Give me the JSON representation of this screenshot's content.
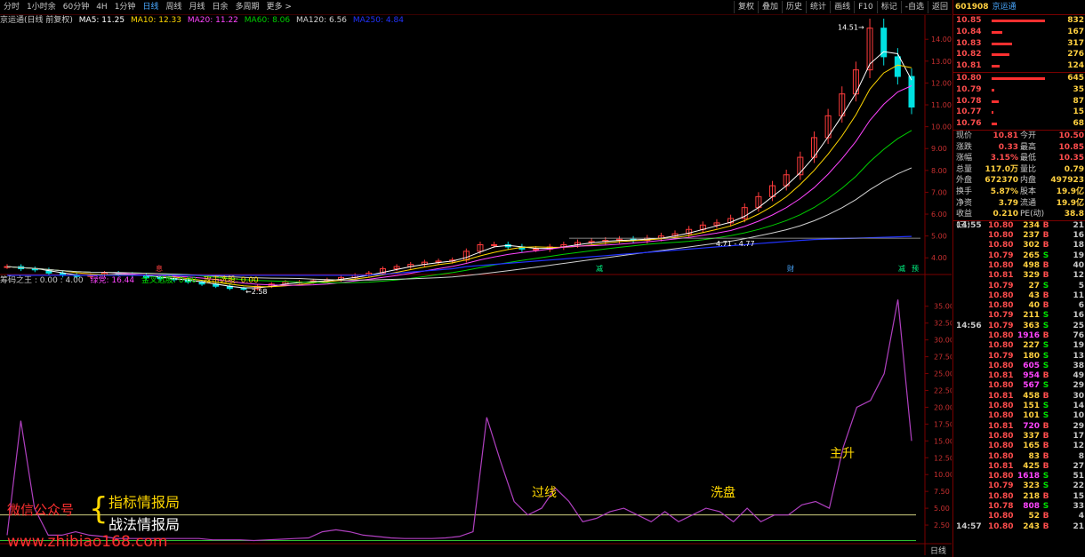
{
  "toolbar": {
    "tabs": [
      "分时",
      "1小时余",
      "60分钟",
      "4H",
      "1分钟",
      "日线",
      "周线",
      "月线",
      "日余",
      "多周期",
      "更多 >"
    ],
    "active_tab": "日线",
    "right_buttons": [
      "复权",
      "叠加",
      "历史",
      "统计",
      "画线",
      "F10",
      "标记",
      "-自选",
      "返回"
    ]
  },
  "info": {
    "title": "京运通(日线 前复权)",
    "ma5": "MA5: 11.25",
    "ma10": "MA10: 12.33",
    "ma20": "MA20: 11.22",
    "ma60": "MA60: 8.06",
    "ma120": "MA120: 6.56",
    "ma250": "MA250: 4.84"
  },
  "colors": {
    "up": "#ff3b3b",
    "down": "#00e0e0",
    "ma5": "#ffffff",
    "ma10": "#ffd700",
    "ma20": "#ff44ff",
    "ma60": "#00d000",
    "ma120": "#d0d0d0",
    "ma250": "#2233ff",
    "indicator": "#b040c0",
    "level_line": "#d0d080",
    "level_line2": "#30c030"
  },
  "chart_data": [
    {
      "type": "line",
      "name": "price",
      "y_ticks": [
        "14.00",
        "13.00",
        "12.00",
        "11.00",
        "10.00",
        "9.00",
        "8.00",
        "7.00",
        "6.00",
        "5.00",
        "4.00"
      ],
      "ylim": [
        3.4,
        14.7
      ],
      "high_label": "14.51",
      "low_label": "2.58",
      "range_label": "4.71 - 4.77",
      "markers": [
        "息",
        "减",
        "财",
        "减",
        "预"
      ],
      "close": [
        3.6,
        3.5,
        3.45,
        3.3,
        3.2,
        3.15,
        3.2,
        3.3,
        3.25,
        3.2,
        3.1,
        3.05,
        3.0,
        2.9,
        2.8,
        2.7,
        2.6,
        2.58,
        2.7,
        2.8,
        2.9,
        2.9,
        2.95,
        3.0,
        3.1,
        3.2,
        3.3,
        3.5,
        3.6,
        3.7,
        3.8,
        3.85,
        3.9,
        4.3,
        4.6,
        4.6,
        4.5,
        4.4,
        4.4,
        4.5,
        4.6,
        4.7,
        4.75,
        4.8,
        4.85,
        4.8,
        4.9,
        5.0,
        5.1,
        5.3,
        5.5,
        5.6,
        5.8,
        6.3,
        6.8,
        7.3,
        7.8,
        8.6,
        9.5,
        10.5,
        11.5,
        12.6,
        14.51,
        13.2,
        12.3,
        10.9
      ],
      "ma250": [
        3.2,
        3.2,
        3.2,
        3.2,
        3.2,
        3.2,
        3.2,
        3.2,
        3.2,
        3.2,
        3.2,
        3.2,
        3.2,
        3.2,
        3.2,
        3.2,
        3.2,
        3.2,
        3.2,
        3.2,
        3.2,
        3.2,
        3.2,
        3.2,
        3.2,
        3.2,
        3.2,
        3.25,
        3.3,
        3.35,
        3.4,
        3.45,
        3.5,
        3.6,
        3.65,
        3.7,
        3.75,
        3.8,
        3.85,
        3.9,
        3.95,
        4.0,
        4.05,
        4.1,
        4.15,
        4.2,
        4.25,
        4.3,
        4.35,
        4.4,
        4.45,
        4.5,
        4.55,
        4.6,
        4.65,
        4.7,
        4.75,
        4.8,
        4.84,
        4.86,
        4.88,
        4.9,
        4.92,
        4.94,
        4.96,
        4.98
      ]
    },
    {
      "type": "line",
      "name": "筹码之王",
      "y_ticks": [
        "35.00",
        "32.50",
        "30.00",
        "27.50",
        "25.00",
        "22.50",
        "20.00",
        "17.50",
        "15.00",
        "12.50",
        "10.00",
        "7.50",
        "5.00",
        "2.50"
      ],
      "ylim": [
        0,
        38
      ],
      "values": [
        1,
        18,
        5,
        1,
        1,
        1.5,
        1,
        0.8,
        0.5,
        0.5,
        0.5,
        0.5,
        0.5,
        0.5,
        0.5,
        0.3,
        0.3,
        0.3,
        0.2,
        0.3,
        0.4,
        0.5,
        0.6,
        1.5,
        1.8,
        1.5,
        1,
        0.8,
        0.6,
        0.5,
        0.5,
        0.5,
        0.6,
        0.8,
        1.5,
        18.5,
        12,
        6,
        4,
        5,
        8,
        6,
        3,
        3.5,
        4.5,
        5,
        4,
        3,
        4.5,
        3,
        4,
        5,
        4.5,
        3,
        5,
        3,
        4,
        4,
        5.5,
        6,
        5,
        14,
        20,
        21,
        25,
        36,
        15
      ]
    },
    {
      "type": "table",
      "name": "order_book",
      "sell": [
        {
          "price": "10.85",
          "vol": "832"
        },
        {
          "price": "10.84",
          "vol": "167"
        },
        {
          "price": "10.83",
          "vol": "317"
        },
        {
          "price": "10.82",
          "vol": "276"
        },
        {
          "price": "10.81",
          "vol": "124"
        }
      ],
      "buy": [
        {
          "price": "10.80",
          "vol": "645"
        },
        {
          "price": "10.79",
          "vol": "35"
        },
        {
          "price": "10.78",
          "vol": "87"
        },
        {
          "price": "10.77",
          "vol": "15"
        },
        {
          "price": "10.76",
          "vol": "68"
        }
      ]
    }
  ],
  "right_panel": {
    "code": "601908",
    "name": "京运通",
    "stats": [
      {
        "k": "现价",
        "v1": "10.81",
        "k2": "今开",
        "v2": "10.50"
      },
      {
        "k": "涨跌",
        "v1": "0.33",
        "k2": "最高",
        "v2": "10.85"
      },
      {
        "k": "涨幅",
        "v1": "3.15%",
        "k2": "最低",
        "v2": "10.35"
      },
      {
        "k": "总量",
        "v1": "117.0万",
        "k2": "量比",
        "v2": "0.79"
      },
      {
        "k": "外盘",
        "v1": "672370",
        "k2": "内盘",
        "v2": "497923"
      },
      {
        "k": "换手",
        "v1": "5.87%",
        "k2": "股本",
        "v2": "19.9亿"
      },
      {
        "k": "净资",
        "v1": "3.79",
        "k2": "流通",
        "v2": "19.9亿"
      },
      {
        "k": "收益(三)",
        "v1": "0.210",
        "k2": "PE(动)",
        "v2": "38.8"
      }
    ],
    "ticks": [
      {
        "t": "14:55",
        "p": "10.80",
        "v": "234",
        "bs": "B",
        "n": "21"
      },
      {
        "t": "",
        "p": "10.80",
        "v": "237",
        "bs": "B",
        "n": "16"
      },
      {
        "t": "",
        "p": "10.80",
        "v": "302",
        "bs": "B",
        "n": "18"
      },
      {
        "t": "",
        "p": "10.79",
        "v": "265",
        "bs": "S",
        "n": "19"
      },
      {
        "t": "",
        "p": "10.80",
        "v": "498",
        "bs": "B",
        "n": "40"
      },
      {
        "t": "",
        "p": "10.81",
        "v": "329",
        "bs": "B",
        "n": "12"
      },
      {
        "t": "",
        "p": "10.79",
        "v": "27",
        "bs": "S",
        "n": "5"
      },
      {
        "t": "",
        "p": "10.80",
        "v": "43",
        "bs": "B",
        "n": "11"
      },
      {
        "t": "",
        "p": "10.80",
        "v": "40",
        "bs": "B",
        "n": "6"
      },
      {
        "t": "",
        "p": "10.79",
        "v": "211",
        "bs": "S",
        "n": "16"
      },
      {
        "t": "14:56",
        "p": "10.79",
        "v": "363",
        "bs": "S",
        "n": "25"
      },
      {
        "t": "",
        "p": "10.80",
        "v": "1916",
        "bs": "B",
        "n": "76"
      },
      {
        "t": "",
        "p": "10.80",
        "v": "227",
        "bs": "S",
        "n": "19"
      },
      {
        "t": "",
        "p": "10.79",
        "v": "180",
        "bs": "S",
        "n": "13"
      },
      {
        "t": "",
        "p": "10.80",
        "v": "605",
        "bs": "S",
        "n": "38"
      },
      {
        "t": "",
        "p": "10.81",
        "v": "954",
        "bs": "B",
        "n": "49"
      },
      {
        "t": "",
        "p": "10.80",
        "v": "567",
        "bs": "S",
        "n": "29"
      },
      {
        "t": "",
        "p": "10.81",
        "v": "458",
        "bs": "B",
        "n": "30"
      },
      {
        "t": "",
        "p": "10.80",
        "v": "151",
        "bs": "S",
        "n": "14"
      },
      {
        "t": "",
        "p": "10.80",
        "v": "101",
        "bs": "S",
        "n": "10"
      },
      {
        "t": "",
        "p": "10.81",
        "v": "720",
        "bs": "B",
        "n": "29"
      },
      {
        "t": "",
        "p": "10.80",
        "v": "337",
        "bs": "B",
        "n": "17"
      },
      {
        "t": "",
        "p": "10.80",
        "v": "165",
        "bs": "B",
        "n": "12"
      },
      {
        "t": "",
        "p": "10.80",
        "v": "83",
        "bs": "B",
        "n": "8"
      },
      {
        "t": "",
        "p": "10.81",
        "v": "425",
        "bs": "B",
        "n": "27"
      },
      {
        "t": "",
        "p": "10.80",
        "v": "1618",
        "bs": "S",
        "n": "51"
      },
      {
        "t": "",
        "p": "10.79",
        "v": "323",
        "bs": "S",
        "n": "22"
      },
      {
        "t": "",
        "p": "10.80",
        "v": "218",
        "bs": "B",
        "n": "15"
      },
      {
        "t": "",
        "p": "10.78",
        "v": "808",
        "bs": "S",
        "n": "33"
      },
      {
        "t": "",
        "p": "10.80",
        "v": "52",
        "bs": "B",
        "n": "4"
      },
      {
        "t": "14:57",
        "p": "10.80",
        "v": "243",
        "bs": "B",
        "n": "21"
      }
    ]
  },
  "indicator": {
    "name": "筹码之王 : 0.00 : 4.00",
    "green": "绿党: 16.44",
    "gold": "金叉选股: 0.00",
    "attack": "攻击选股: 0.00",
    "annotations": [
      "过线",
      "洗盘",
      "主升"
    ]
  },
  "watermark": {
    "wechat": "微信公众号",
    "line1": "指标情报局",
    "line2": "战法情报局",
    "url": "www.zhibiao168.com"
  },
  "bottom_label": "日线"
}
